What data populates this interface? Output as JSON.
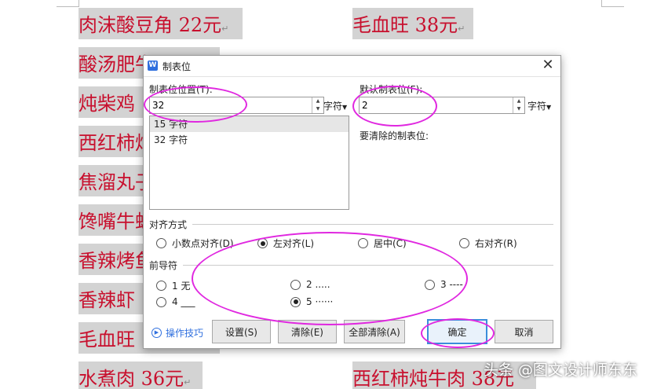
{
  "document": {
    "left_lines": [
      "肉沫酸豆角 22元",
      "酸汤肥牛",
      "炖柴鸡",
      "西红柿炖",
      "焦溜丸子",
      "馋嘴牛蛙",
      "香辣烤鱼",
      "香辣虾",
      "毛血旺",
      "水煮肉 36元"
    ],
    "right_lines": [
      "毛血旺 38元",
      "西红柿炖牛肉 38元"
    ],
    "paragraph_mark": "↵"
  },
  "dialog": {
    "title": "制表位",
    "close_glyph": "✕",
    "tab_position": {
      "label": "制表位位置(T):",
      "value": "32",
      "unit": "字符"
    },
    "tab_list": [
      "15 字符",
      "32 字符"
    ],
    "default_tab": {
      "label": "默认制表位(F):",
      "value": "2",
      "unit": "字符"
    },
    "clear_label": "要清除的制表位:",
    "alignment": {
      "label": "对齐方式",
      "options": [
        "小数点对齐(D)",
        "左对齐(L)",
        "居中(C)",
        "右对齐(R)"
      ],
      "selected": "左对齐(L)"
    },
    "leader": {
      "label": "前导符",
      "options": [
        "1 无",
        "2 .....",
        "3 ----",
        "4 ___",
        "5 ······"
      ],
      "selected": "5 ······"
    },
    "tips": "操作技巧",
    "buttons": {
      "set": "设置(S)",
      "clear": "清除(E)",
      "clear_all": "全部清除(A)",
      "ok": "确定",
      "cancel": "取消"
    }
  },
  "watermark": "头条 @图文设计师东东",
  "colors": {
    "doc_text": "#c8102e",
    "highlight_bg": "#d3d3d3",
    "annotation": "#e028e0",
    "accent": "#3b8ddb"
  }
}
